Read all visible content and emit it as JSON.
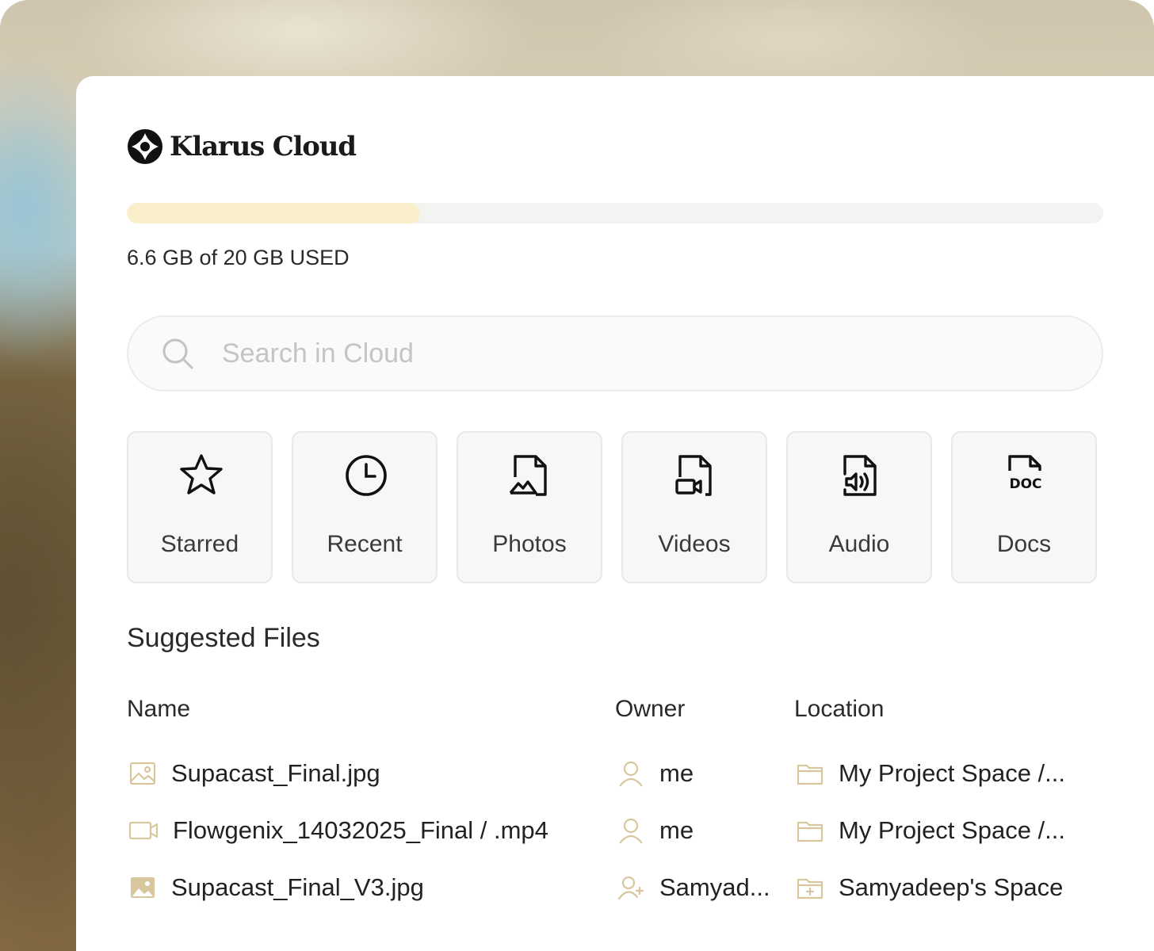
{
  "app": {
    "name": "Klarus Cloud"
  },
  "storage": {
    "used_fraction": 0.3,
    "label": "6.6 GB of 20 GB USED"
  },
  "search": {
    "placeholder": "Search in Cloud"
  },
  "categories": [
    {
      "label": "Starred",
      "icon": "star-icon"
    },
    {
      "label": "Recent",
      "icon": "clock-icon"
    },
    {
      "label": "Photos",
      "icon": "photo-file-icon"
    },
    {
      "label": "Videos",
      "icon": "video-file-icon"
    },
    {
      "label": "Audio",
      "icon": "audio-file-icon"
    },
    {
      "label": "Docs",
      "icon": "doc-file-icon",
      "badge": "DOC"
    }
  ],
  "suggested": {
    "title": "Suggested Files",
    "columns": {
      "name": "Name",
      "owner": "Owner",
      "location": "Location"
    },
    "rows": [
      {
        "name": "Supacast_Final.jpg",
        "file_icon": "image-icon",
        "owner": "me",
        "owner_icon": "user-icon",
        "location": "My Project Space /...",
        "location_icon": "folder-icon"
      },
      {
        "name": "Flowgenix_14032025_Final / .mp4",
        "file_icon": "video-icon",
        "owner": "me",
        "owner_icon": "user-icon",
        "location": "My Project Space /...",
        "location_icon": "folder-icon"
      },
      {
        "name": "Supacast_Final_V3.jpg",
        "file_icon": "image-filled-icon",
        "owner": "Samyad...",
        "owner_icon": "shared-user-icon",
        "location": "Samyadeep's Space",
        "location_icon": "shared-folder-icon"
      }
    ]
  },
  "colors": {
    "accent": "#faefcb",
    "icon_gold": "#d8c79c",
    "text": "#222222"
  }
}
